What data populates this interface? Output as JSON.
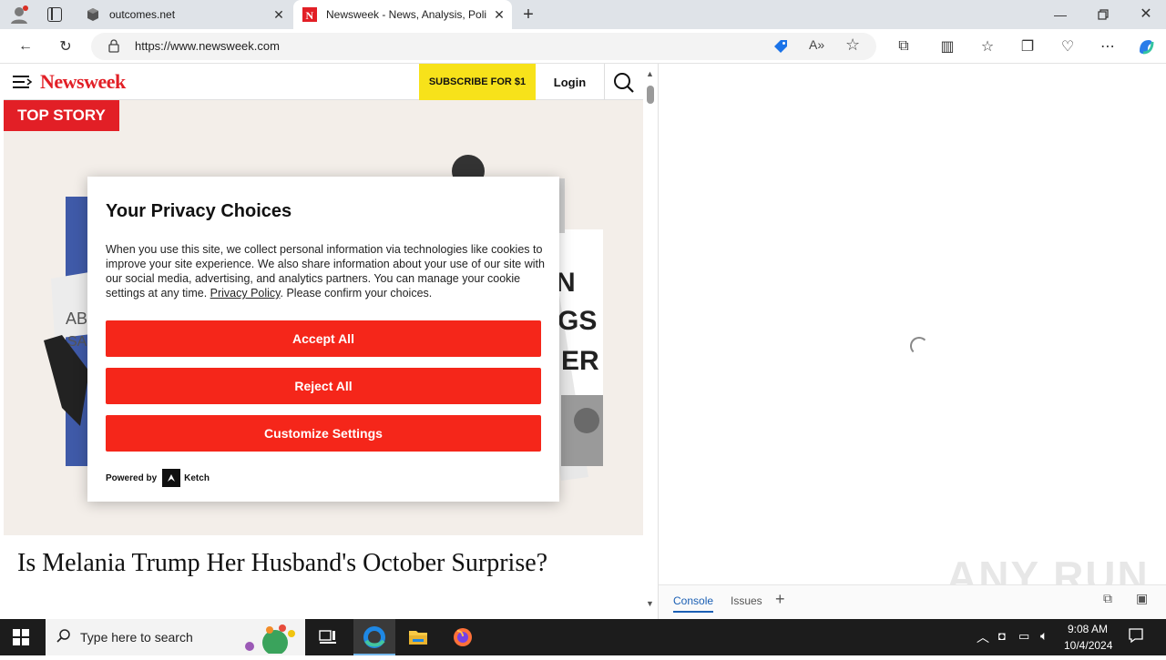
{
  "browser": {
    "tabs": [
      {
        "title": "outcomes.net",
        "active": false
      },
      {
        "title": "Newsweek - News, Analysis, Politics",
        "active": true
      }
    ],
    "url": "https://www.newsweek.com"
  },
  "newsweek": {
    "logo": "Newsweek",
    "subscribe_label": "SUBSCRIBE FOR $1",
    "login_label": "Login",
    "top_story_label": "TOP STORY",
    "headline": "Is Melania Trump Her Husband's October Surprise?"
  },
  "privacy_modal": {
    "title": "Your Privacy Choices",
    "body_before_link": "When you use this site, we collect personal information via technologies like cookies to improve your site experience. We also share information about your use of our site with our social media, advertising, and analytics partners. You can manage your cookie settings at any time. ",
    "privacy_link": "Privacy Policy",
    "body_after_link": ". Please confirm your choices.",
    "accept_label": "Accept All",
    "reject_label": "Reject All",
    "customize_label": "Customize Settings",
    "powered_by": "Powered by",
    "vendor": "Ketch"
  },
  "devtools": {
    "tabs": [
      "Console",
      "Issues"
    ]
  },
  "watermark": "ANY RUN",
  "taskbar": {
    "search_placeholder": "Type here to search",
    "time": "9:08 AM",
    "date": "10/4/2024"
  },
  "colors": {
    "accent_red": "#e21f26",
    "button_red": "#f5261a",
    "subscribe_yellow": "#f7e21a"
  }
}
